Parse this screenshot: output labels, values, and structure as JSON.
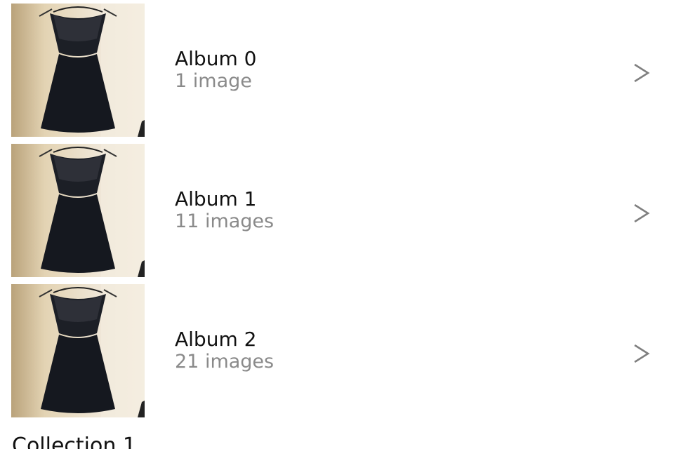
{
  "albums": [
    {
      "title": "Album 0",
      "count": "1 image"
    },
    {
      "title": "Album 1",
      "count": "11 images"
    },
    {
      "title": "Album 2",
      "count": "21 images"
    }
  ],
  "section": {
    "heading": "Collection 1"
  },
  "icons": {
    "chevron": "chevron-right-icon",
    "thumbnail": "dress-photo"
  },
  "colors": {
    "title_text": "#111111",
    "count_text": "#8a8a8a",
    "chevron": "#7f7f7f",
    "background": "#ffffff"
  }
}
